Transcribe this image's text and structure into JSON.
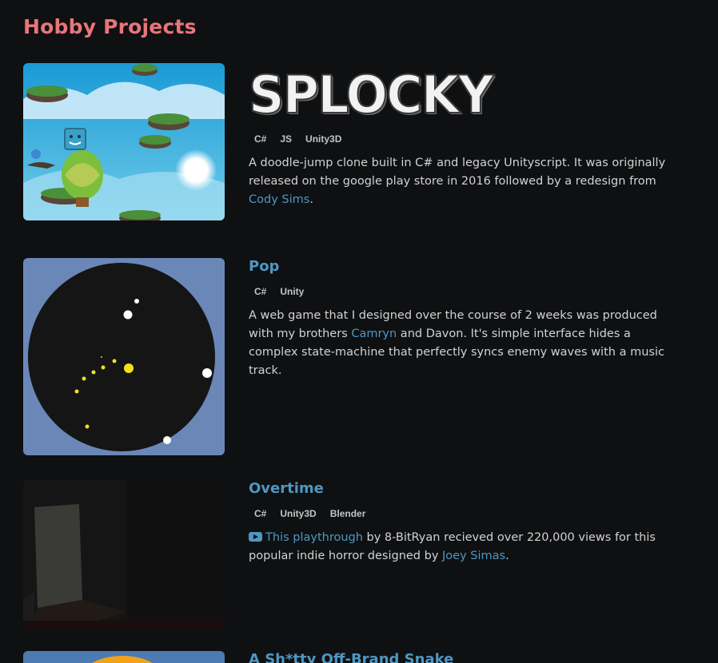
{
  "section": {
    "title": "Hobby Projects"
  },
  "projects": [
    {
      "title": "SPLOCKY",
      "tags": [
        "C#",
        "JS",
        "Unity3D"
      ],
      "desc_part1": "A doodle-jump clone built in C# and legacy Unityscript. It was originally released on the google play store in 2016 followed by a redesign from ",
      "desc_link1": "Cody Sims",
      "desc_part2": "."
    },
    {
      "title": "Pop",
      "tags": [
        "C#",
        "Unity"
      ],
      "desc_part1": "A web game that I designed over the course of 2 weeks was produced with my brothers ",
      "desc_link1": "Camryn",
      "desc_part2": " and Davon. It's simple interface hides a complex state-machine that perfectly syncs enemy waves with a music track."
    },
    {
      "title": "Overtime",
      "tags": [
        "C#",
        "Unity3D",
        "Blender"
      ],
      "desc_link0": "This playthrough",
      "desc_part1": " by 8-BitRyan recieved over 220,000 views for this popular indie horror designed by ",
      "desc_link1": "Joey Simas",
      "desc_part2": ".",
      "icon": "youtube-icon"
    },
    {
      "title": "A Sh*tty Off-Brand Snake"
    }
  ],
  "colors": {
    "background": "#0f1012",
    "heading_accent": "#e9757a",
    "link": "#4d97c2",
    "text": "#d2d2d2"
  }
}
